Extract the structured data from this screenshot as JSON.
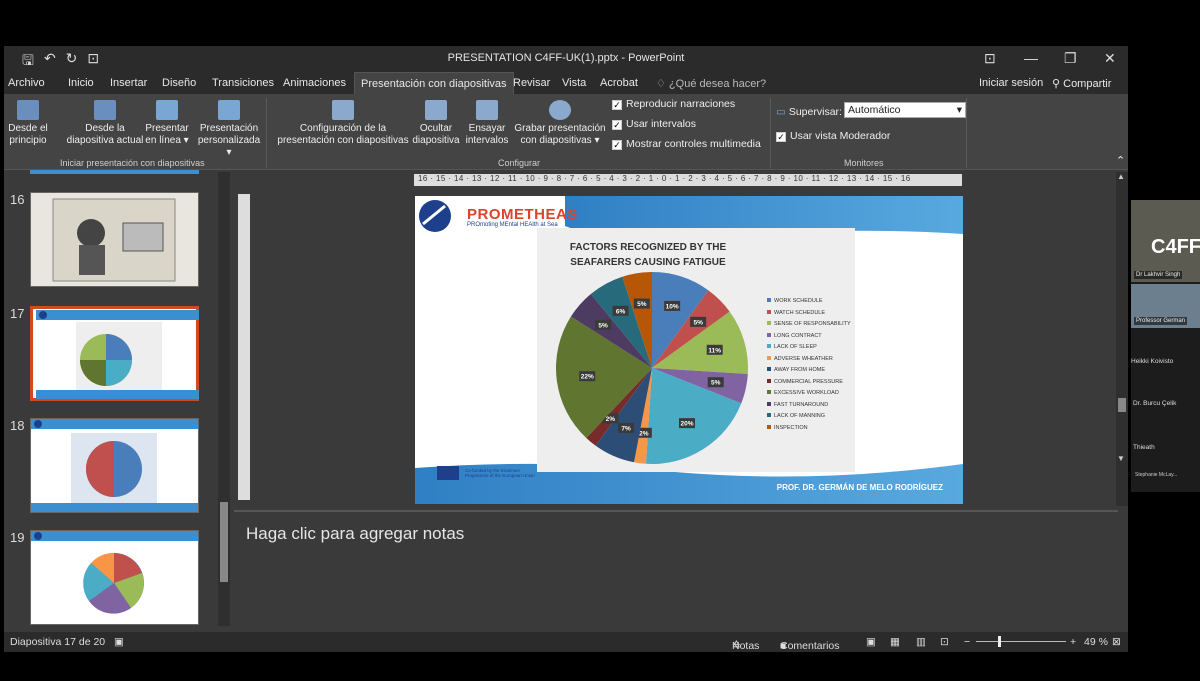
{
  "window": {
    "title": "PRESENTATION C4FF-UK(1).pptx - PowerPoint"
  },
  "menu": {
    "tabs": [
      "Archivo",
      "Inicio",
      "Insertar",
      "Diseño",
      "Transiciones",
      "Animaciones",
      "Presentación con diapositivas",
      "Revisar",
      "Vista",
      "Acrobat"
    ],
    "tell_me": "¿Qué desea hacer?",
    "signin": "Iniciar sesión",
    "share": "Compartir"
  },
  "ribbon": {
    "from_start": [
      "Desde el",
      "principio"
    ],
    "from_current": [
      "Desde la",
      "diapositiva actual"
    ],
    "present_online": [
      "Presentar",
      "en línea ▾"
    ],
    "custom": [
      "Presentación",
      "personalizada ▾"
    ],
    "group1": "Iniciar presentación con diapositivas",
    "setup": [
      "Configuración de la",
      "presentación con diapositivas"
    ],
    "hide": [
      "Ocultar",
      "diapositiva"
    ],
    "rehearse": [
      "Ensayar",
      "intervalos"
    ],
    "record": [
      "Grabar presentación",
      "con diapositivas ▾"
    ],
    "chk_narrations": "Reproducir narraciones",
    "chk_timings": "Usar intervalos",
    "chk_media": "Mostrar controles multimedia",
    "group2": "Configurar",
    "monitor_label": "Supervisar:",
    "monitor_value": "Automático",
    "chk_presenter": "Usar vista Moderador",
    "group3": "Monitores"
  },
  "thumbnails": [
    {
      "num": "16"
    },
    {
      "num": "17"
    },
    {
      "num": "18"
    },
    {
      "num": "19"
    }
  ],
  "ruler_h": "16 · 15 · 14 · 13 · 12 · 11 · 10 · 9 · 8 · 7 · 6 · 5 · 4 · 3 · 2 · 1 · 0 · 1 · 2 · 3 · 4 · 5 · 6 · 7 · 8 · 9 · 10 · 11 · 12 · 13 · 14 · 15 · 16",
  "slide": {
    "brand": "PROMETHEAS",
    "brand_sub": "PROmoting MEntal HEAlth at Sea",
    "chart_title": "FACTORS RECOGNIZED BY THE SEAFARERS CAUSING FATIGUE",
    "eu_text": "Co-funded by the Erasmus+ Programme of the European Union",
    "footer": "PROF. DR. GERMÁN DE MELO RODRÍGUEZ"
  },
  "chart_data": {
    "type": "pie",
    "title": "FACTORS RECOGNIZED BY THE SEAFARERS CAUSING FATIGUE",
    "legend": "right",
    "series": [
      {
        "name": "WORK SCHEDULE",
        "value": 10,
        "color": "#4a7ebb"
      },
      {
        "name": "WATCH SCHEDULE",
        "value": 5,
        "color": "#c0504d"
      },
      {
        "name": "SENSE OF RESPONSABILITY",
        "value": 11,
        "color": "#9bbb59"
      },
      {
        "name": "LONG CONTRACT",
        "value": 5,
        "color": "#8064a2"
      },
      {
        "name": "LACK OF SLEEP",
        "value": 20,
        "color": "#4bacc6"
      },
      {
        "name": "ADVERSE WHEATHER",
        "value": 2,
        "color": "#f79646"
      },
      {
        "name": "AWAY FROM HOME",
        "value": 7,
        "color": "#2c4d75"
      },
      {
        "name": "COMMERCIAL PRESSURE",
        "value": 2,
        "color": "#772c2a"
      },
      {
        "name": "EXCESSIVE WORKLOAD",
        "value": 22,
        "color": "#5f7530"
      },
      {
        "name": "FAST TURNAROUND",
        "value": 5,
        "color": "#4d3b62"
      },
      {
        "name": "LACK OF MANNING",
        "value": 6,
        "color": "#276a7c"
      },
      {
        "name": "INSPECTION",
        "value": 5,
        "color": "#b65708"
      }
    ]
  },
  "notes_placeholder": "Haga clic para agregar notas",
  "status": {
    "slide_info": "Diapositiva 17 de 20",
    "notes": "Notas",
    "comments": "Comentarios",
    "zoom": "49 %"
  },
  "meeting": {
    "p1": "Dr Lakhvir Singh",
    "p2": "Professor German",
    "p3": "Heikki Koivisto",
    "p4": "Dr. Burcu Çelik",
    "p5": "Thieath",
    "p6": "Stephanie McLay...",
    "logo": "C4FF"
  }
}
